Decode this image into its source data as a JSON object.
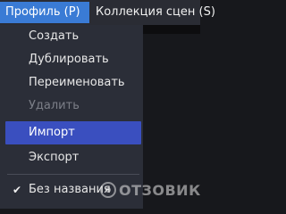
{
  "menubar": {
    "profile_label": "Профиль (P)",
    "scenes_label": "Коллекция сцен (S)"
  },
  "dropdown": {
    "items": [
      {
        "label": "Создать",
        "state": "enabled"
      },
      {
        "label": "Дублировать",
        "state": "enabled"
      },
      {
        "label": "Переименовать",
        "state": "enabled"
      },
      {
        "label": "Удалить",
        "state": "disabled"
      },
      {
        "label": "Импорт",
        "state": "highlighted"
      },
      {
        "label": "Экспорт",
        "state": "enabled"
      },
      {
        "label": "Без названия",
        "state": "checked",
        "icon": "checkmark-icon"
      }
    ]
  },
  "colors": {
    "highlight": "#3a4fbf",
    "menubar_active": "#3a7bd5",
    "dropdown_bg": "#2b2e38",
    "background": "#17181c"
  },
  "watermark": {
    "text": "ОТЗОВИК"
  }
}
